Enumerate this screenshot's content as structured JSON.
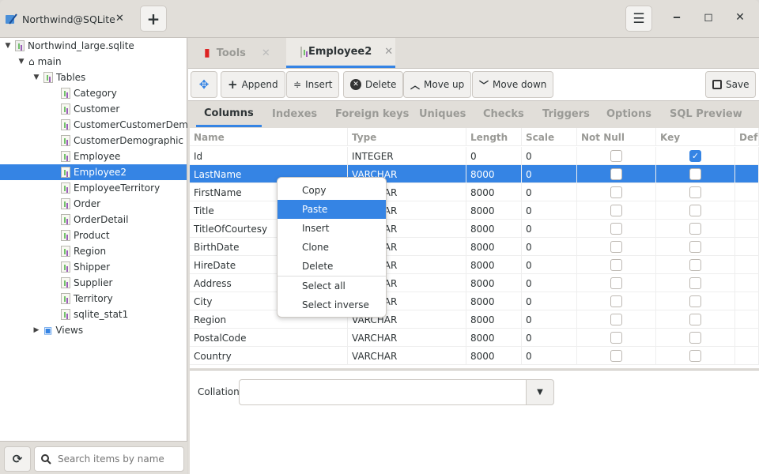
{
  "titlebar": {
    "tab_title": "Northwind@SQLite",
    "new_tab_label": "+",
    "menu_icon": "☰",
    "minimize": "‒",
    "maximize": "◻",
    "close": "✕"
  },
  "sidebar": {
    "database": "Northwind_large.sqlite",
    "schema": "main",
    "tables_label": "Tables",
    "tables": [
      "Category",
      "Customer",
      "CustomerCustomerDemo",
      "CustomerDemographic",
      "Employee",
      "Employee2",
      "EmployeeTerritory",
      "Order",
      "OrderDetail",
      "Product",
      "Region",
      "Shipper",
      "Supplier",
      "Territory",
      "sqlite_stat1"
    ],
    "selected_table": "Employee2",
    "views_label": "Views",
    "search_placeholder": "Search items by name"
  },
  "doc_tabs": [
    {
      "label": "Tools",
      "active": false
    },
    {
      "label": "Employee2",
      "active": true
    }
  ],
  "toolbar": {
    "append": "Append",
    "insert": "Insert",
    "delete": "Delete",
    "move_up": "Move up",
    "move_down": "Move down",
    "save": "Save"
  },
  "subtabs": [
    "Columns",
    "Indexes",
    "Foreign keys",
    "Uniques",
    "Checks",
    "Triggers",
    "Options",
    "SQL Preview"
  ],
  "active_subtab": "Columns",
  "grid": {
    "headers": [
      "Name",
      "Type",
      "Length",
      "Scale",
      "Not Null",
      "Key",
      "Def"
    ],
    "rows": [
      {
        "name": "Id",
        "type": "INTEGER",
        "length": "0",
        "scale": "0",
        "not_null": false,
        "key": true
      },
      {
        "name": "LastName",
        "type": "VARCHAR",
        "length": "8000",
        "scale": "0",
        "not_null": false,
        "key": false
      },
      {
        "name": "FirstName",
        "type": "VARCHAR",
        "length": "8000",
        "scale": "0",
        "not_null": false,
        "key": false
      },
      {
        "name": "Title",
        "type": "VARCHAR",
        "length": "8000",
        "scale": "0",
        "not_null": false,
        "key": false
      },
      {
        "name": "TitleOfCourtesy",
        "type": "VARCHAR",
        "length": "8000",
        "scale": "0",
        "not_null": false,
        "key": false
      },
      {
        "name": "BirthDate",
        "type": "VARCHAR",
        "length": "8000",
        "scale": "0",
        "not_null": false,
        "key": false
      },
      {
        "name": "HireDate",
        "type": "VARCHAR",
        "length": "8000",
        "scale": "0",
        "not_null": false,
        "key": false
      },
      {
        "name": "Address",
        "type": "VARCHAR",
        "length": "8000",
        "scale": "0",
        "not_null": false,
        "key": false
      },
      {
        "name": "City",
        "type": "VARCHAR",
        "length": "8000",
        "scale": "0",
        "not_null": false,
        "key": false
      },
      {
        "name": "Region",
        "type": "VARCHAR",
        "length": "8000",
        "scale": "0",
        "not_null": false,
        "key": false
      },
      {
        "name": "PostalCode",
        "type": "VARCHAR",
        "length": "8000",
        "scale": "0",
        "not_null": false,
        "key": false
      },
      {
        "name": "Country",
        "type": "VARCHAR",
        "length": "8000",
        "scale": "0",
        "not_null": false,
        "key": false
      }
    ],
    "selected_row": 1
  },
  "collation": {
    "label": "Collation",
    "value": ""
  },
  "context_menu": {
    "items": [
      "Copy",
      "Paste",
      "Insert",
      "Clone",
      "Delete",
      "Select all",
      "Select inverse"
    ],
    "highlighted": "Paste"
  },
  "colors": {
    "accent": "#3584e4",
    "bg": "#e1ded9"
  }
}
